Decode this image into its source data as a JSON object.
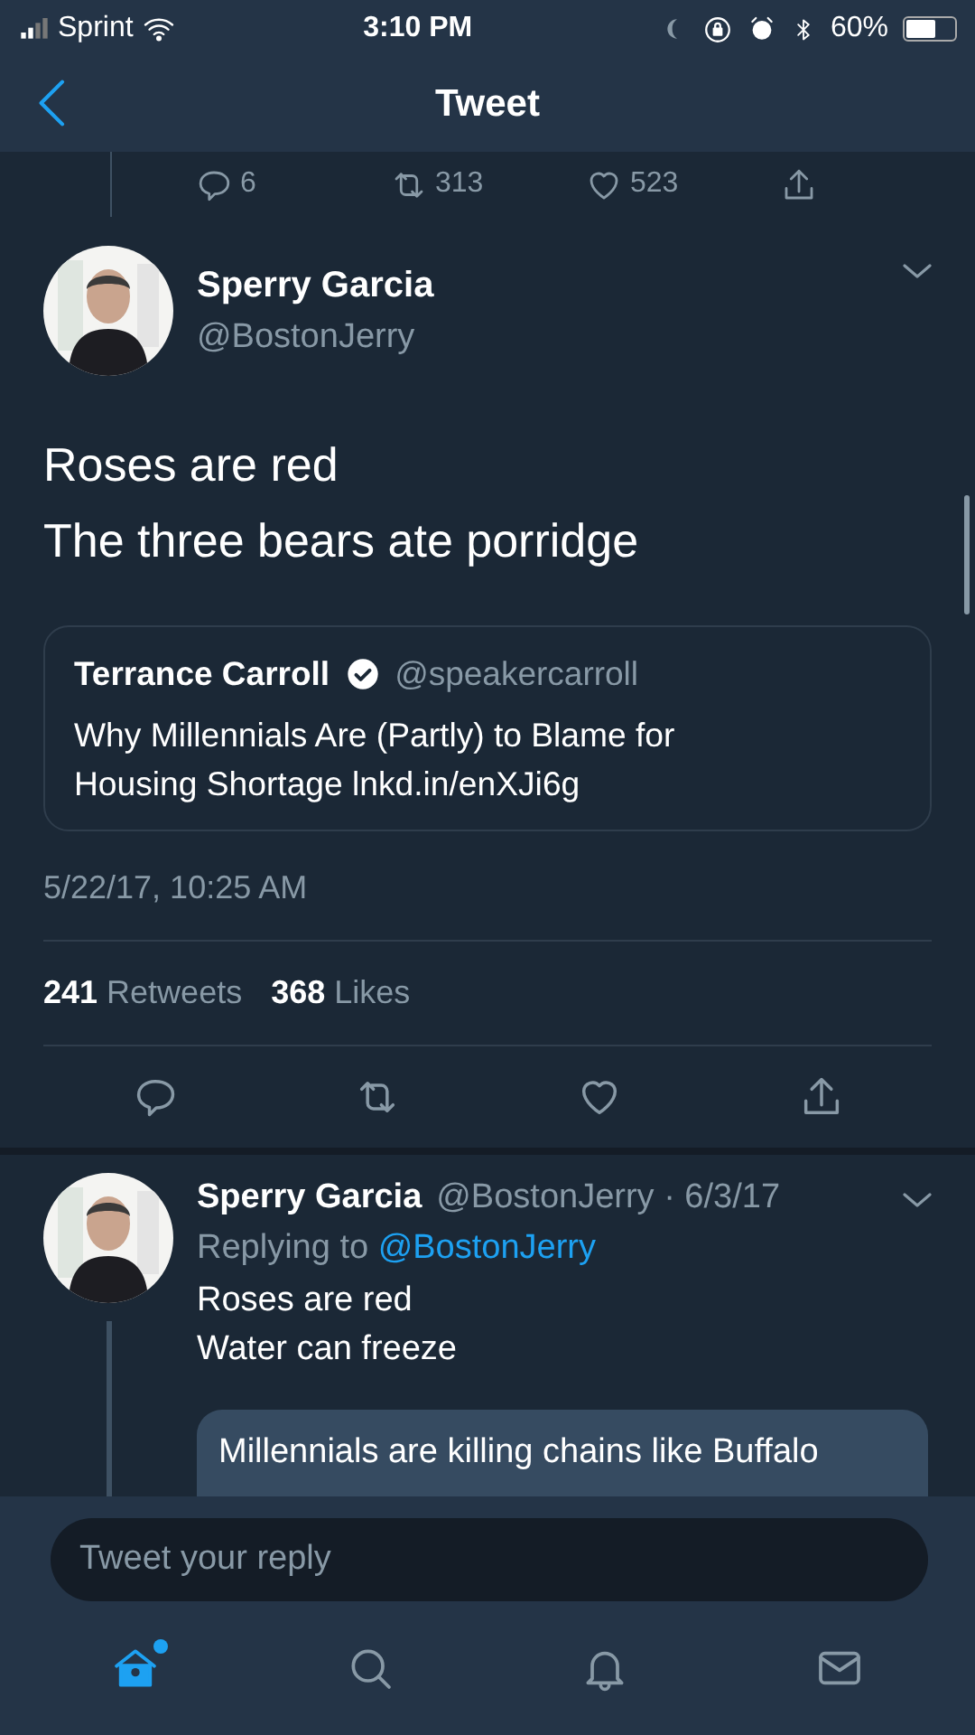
{
  "status_bar": {
    "carrier": "Sprint",
    "time": "3:10 PM",
    "battery": "60%"
  },
  "nav": {
    "title": "Tweet"
  },
  "previous_actions": [
    {
      "kind": "reply",
      "count": "6"
    },
    {
      "kind": "retweet",
      "count": "313"
    },
    {
      "kind": "like",
      "count": "523"
    },
    {
      "kind": "share"
    }
  ],
  "tweet": {
    "name": "Sperry Garcia",
    "handle": "@BostonJerry",
    "lines": [
      "Roses are red",
      "The three bears ate porridge"
    ],
    "quote": {
      "name": "Terrance Carroll",
      "verified": true,
      "handle": "@speakercarroll",
      "text": "Why Millennials Are (Partly) to Blame for Housing Shortage lnkd.in/enXJi6g"
    },
    "timestamp": "5/22/17, 10:25 AM",
    "stats": [
      "**241** Retweets",
      "**368** Likes"
    ],
    "actions": [
      {
        "kind": "reply"
      },
      {
        "kind": "retweet"
      },
      {
        "kind": "like"
      },
      {
        "kind": "share"
      }
    ]
  },
  "reply": {
    "name": "Sperry Garcia",
    "handle_date": "@BostonJerry · 6/3/17",
    "replying_prefix": "Replying to",
    "replying_handle": "@BostonJerry",
    "lines": [
      "Roses are red",
      "Water can freeze"
    ],
    "card_text": "Millennials are killing chains like Buffalo"
  },
  "composer": {
    "placeholder": "Tweet your reply"
  },
  "tab_bar": [
    {
      "kind": "home",
      "selected": true,
      "dot": true
    },
    {
      "kind": "search",
      "selected": false,
      "dot": false
    },
    {
      "kind": "notifications",
      "selected": false,
      "dot": false
    },
    {
      "kind": "messages",
      "selected": false,
      "dot": false
    }
  ]
}
